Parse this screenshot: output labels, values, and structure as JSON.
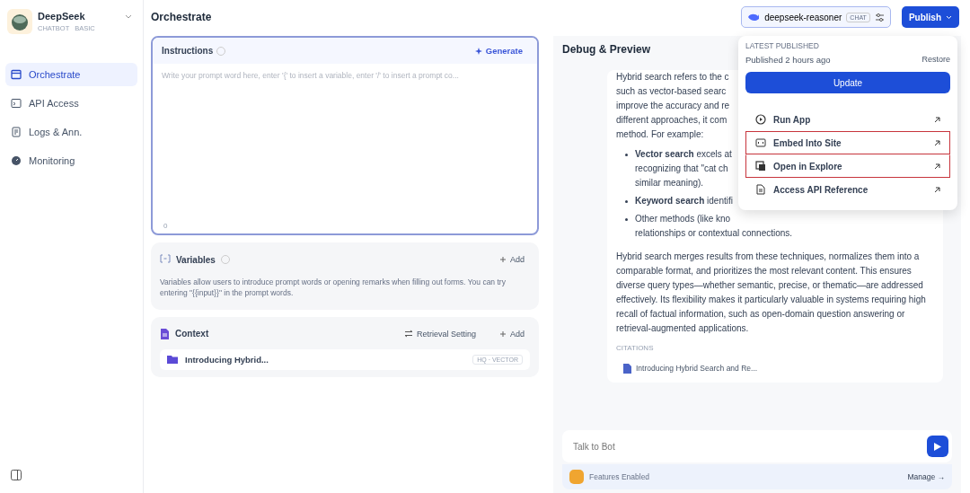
{
  "app": {
    "name": "DeepSeek",
    "tags": [
      "CHATBOT",
      "BASIC"
    ]
  },
  "sidebar": {
    "items": [
      {
        "label": "Orchestrate",
        "selected": true
      },
      {
        "label": "API Access",
        "selected": false
      },
      {
        "label": "Logs & Ann.",
        "selected": false
      },
      {
        "label": "Monitoring",
        "selected": false
      }
    ]
  },
  "header": {
    "title": "Orchestrate",
    "model": {
      "name": "deepseek-reasoner",
      "badge": "CHAT"
    },
    "publish": "Publish"
  },
  "instructions": {
    "title": "Instructions",
    "generate": "Generate",
    "placeholder": "Write your prompt word here, enter '{' to insert a variable, enter '/' to insert a prompt co...",
    "count": "0"
  },
  "variables": {
    "title": "Variables",
    "add": "Add",
    "description": "Variables allow users to introduce prompt words or opening remarks when filling out forms. You can try entering \"{{input}}\" in the prompt words."
  },
  "context": {
    "title": "Context",
    "retrieval": "Retrieval Setting",
    "add": "Add",
    "items": [
      {
        "name": "Introducing Hybrid...",
        "badge": "HQ · VECTOR"
      }
    ]
  },
  "debug": {
    "title": "Debug & Preview",
    "intro_lines": [
      "Hybrid search refers to the c",
      "such as vector-based searc",
      "improve the accuracy and re",
      "different approaches, it com",
      "method. For example:"
    ],
    "bullets": [
      {
        "lines": [
          "**Vector search** excels at",
          "recognizing that \"cat ch",
          "similar meaning)."
        ]
      },
      {
        "lines": [
          "**Keyword search** identifi"
        ]
      },
      {
        "lines": [
          "Other methods (like kno",
          "relationships or contextual connections."
        ]
      }
    ],
    "paragraph": "Hybrid search merges results from these techniques, normalizes them into a comparable format, and prioritizes the most relevant content. This ensures diverse query types—whether semantic, precise, or thematic—are addressed effectively. Its flexibility makes it particularly valuable in systems requiring high recall of factual information, such as open-domain question answering or retrieval-augmented applications.",
    "citations_label": "CITATIONS",
    "citations": [
      "Introducing Hybrid Search and Re..."
    ],
    "chat_placeholder": "Talk to Bot",
    "features": "Features Enabled",
    "manage": "Manage →"
  },
  "publish_menu": {
    "label": "LATEST PUBLISHED",
    "status": "Published 2 hours ago",
    "restore": "Restore",
    "update": "Update",
    "items": [
      {
        "label": "Run App",
        "highlighted": false
      },
      {
        "label": "Embed Into Site",
        "highlighted": true
      },
      {
        "label": "Open in Explore",
        "highlighted": true
      },
      {
        "label": "Access API Reference",
        "highlighted": false
      }
    ]
  }
}
